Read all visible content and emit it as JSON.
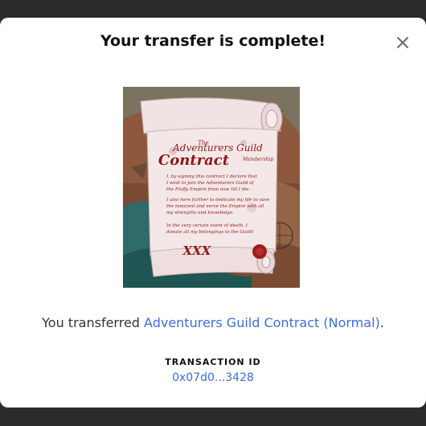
{
  "modal": {
    "title": "Your transfer is complete!",
    "close_icon": "close-icon"
  },
  "nft": {
    "image_text": {
      "heading_line1": "The",
      "heading_line2": "Adventurers Guild",
      "heading_contract": "Contract",
      "heading_membership": "Membership",
      "body_lines": [
        "I, by signing this contract I declare that",
        "I wish to join the Adventurers Guild of",
        "the Fluffy Empire from now till I die.",
        "I also here further to dedicate my life to save",
        "the innocent and serve the Empire with all",
        "my strengths and knowledge.",
        "In the very certain event of death, I",
        "donate all my belongings to the Guild!"
      ],
      "signature": "XXX"
    },
    "colors": {
      "parchment": "#f1e3e3",
      "ink": "#8b1a1a",
      "map_teal": "#2f6b68",
      "map_brown": "#8a5a3c"
    }
  },
  "message": {
    "prefix": "You transferred ",
    "link_text": "Adventurers Guild Contract (Normal)",
    "suffix": "."
  },
  "transaction": {
    "label": "TRANSACTION ID",
    "value": "0x07d0...3428"
  }
}
